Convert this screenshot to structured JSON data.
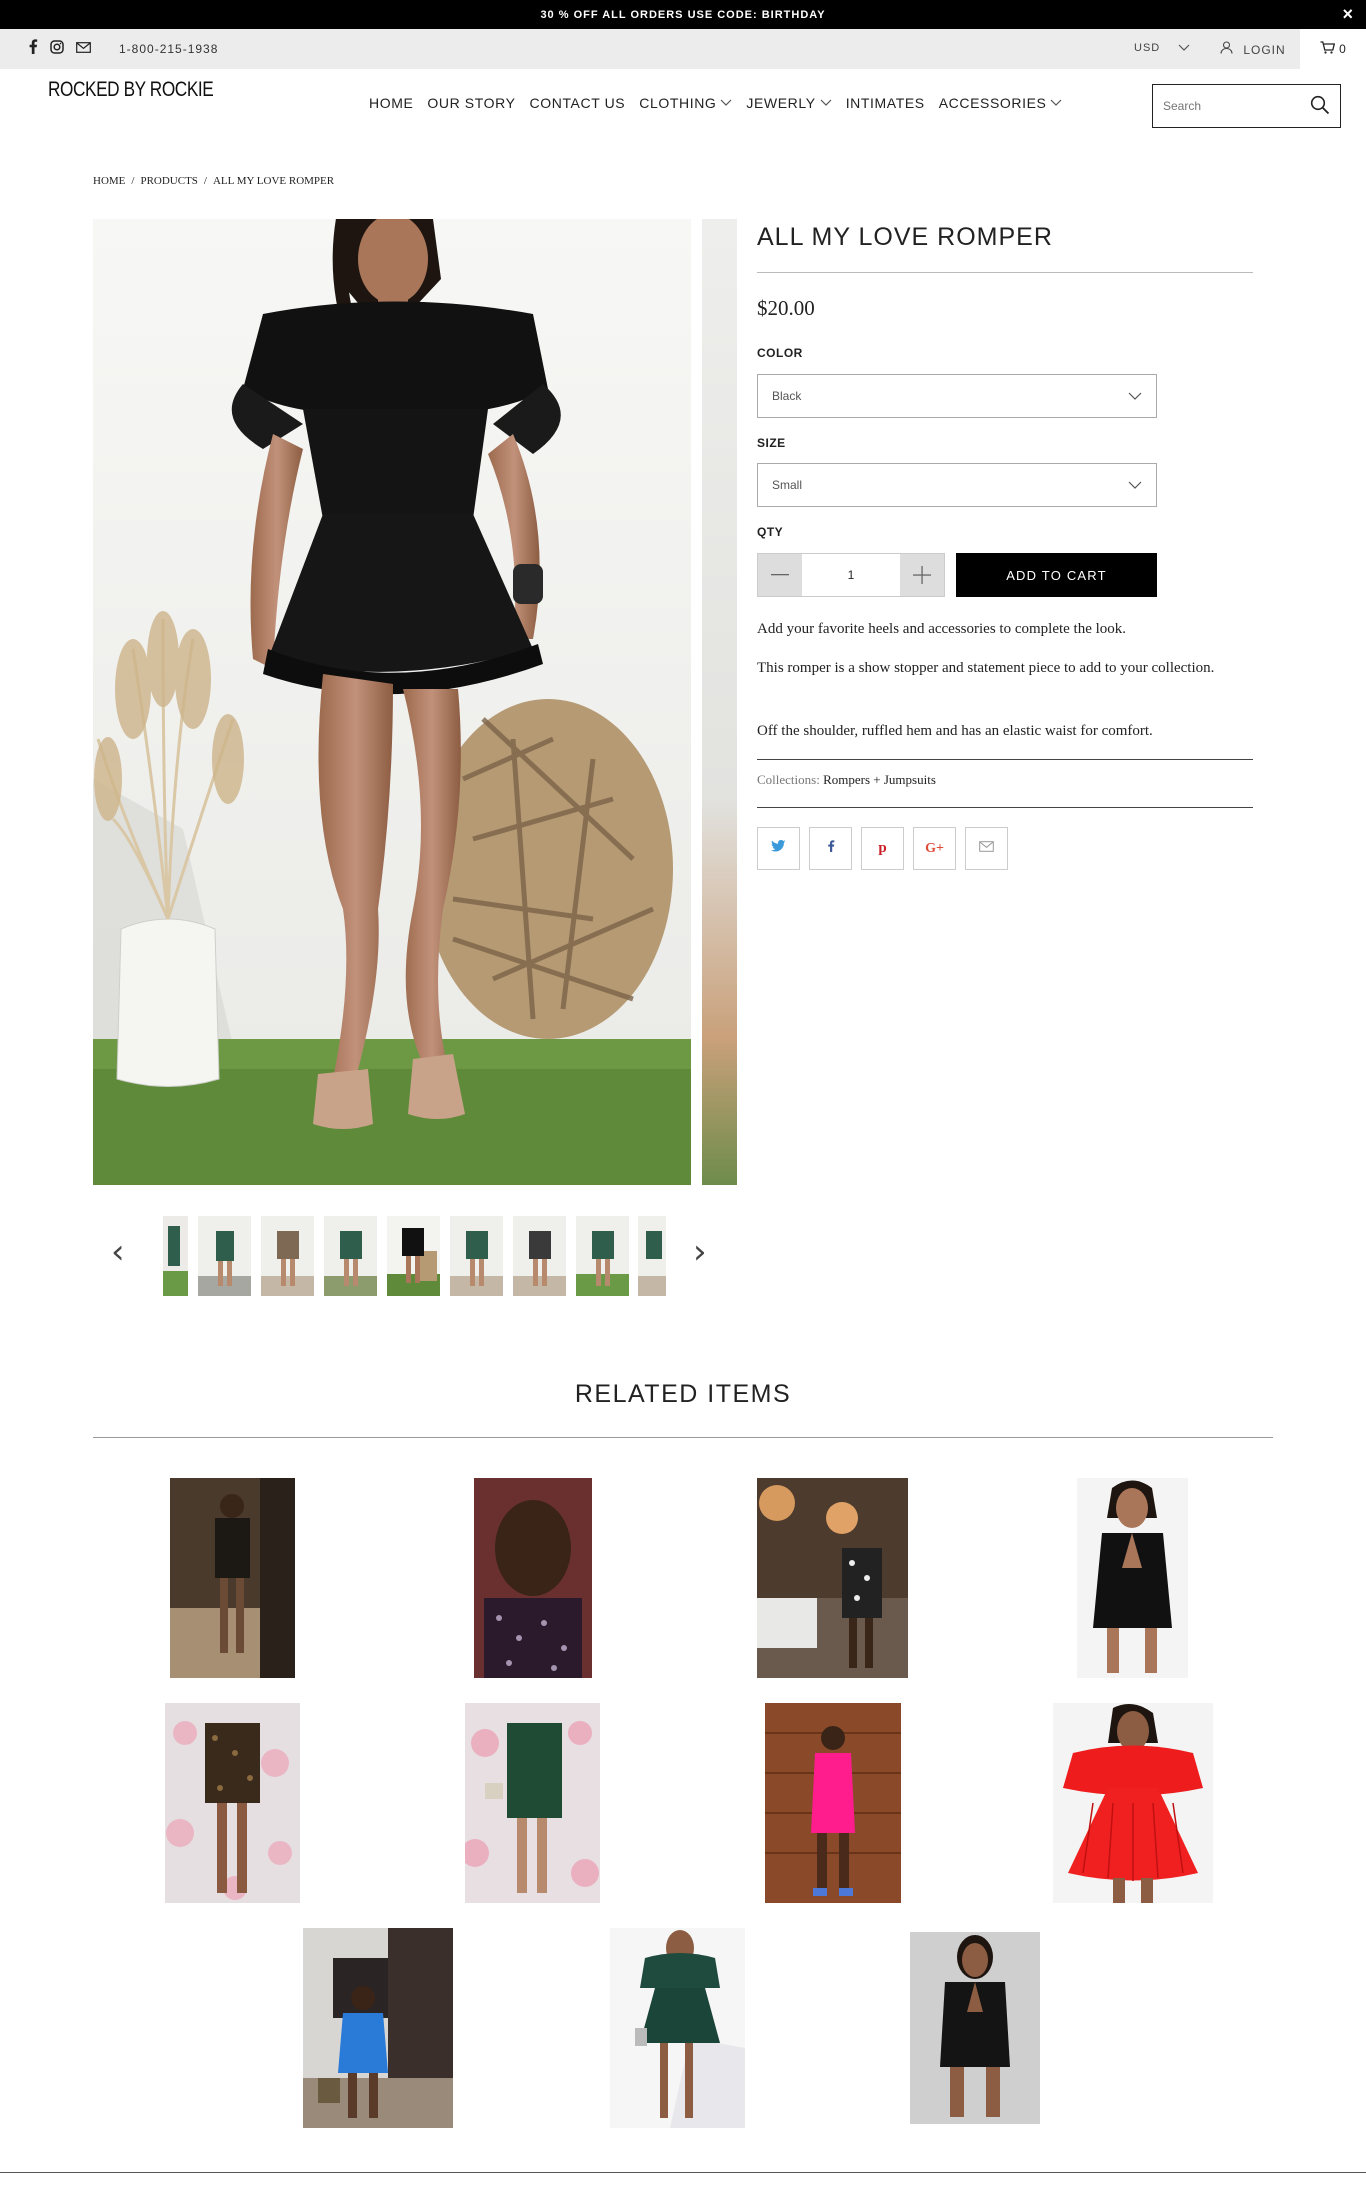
{
  "promo": {
    "text": "30 % OFF ALL ORDERS USE CODE: BIRTHDAY",
    "close": "×"
  },
  "topbar": {
    "phone": "1-800-215-1938",
    "currency": "USD",
    "login": "LOGIN",
    "cart_count": "0"
  },
  "brand": {
    "name": "ROCKED BY ROCKIE"
  },
  "nav": {
    "items": [
      {
        "label": "HOME"
      },
      {
        "label": "OUR STORY"
      },
      {
        "label": "CONTACT US"
      },
      {
        "label": "CLOTHING"
      },
      {
        "label": "JEWERLY"
      },
      {
        "label": "INTIMATES"
      },
      {
        "label": "ACCESSORIES"
      }
    ]
  },
  "search": {
    "placeholder": "Search"
  },
  "breadcrumb": {
    "home": "HOME",
    "products": "PRODUCTS",
    "current": "ALL MY LOVE ROMPER",
    "sep": "/"
  },
  "product": {
    "title": "ALL MY LOVE ROMPER",
    "price": "$20.00",
    "color_label": "COLOR",
    "color_value": "Black",
    "size_label": "SIZE",
    "size_value": "Small",
    "qty_label": "QTY",
    "qty_value": "1",
    "add_to_cart": "ADD TO CART",
    "description": [
      "Add your favorite heels and accessories to complete the look.",
      "This romper is a show stopper and statement piece to add to your collection.",
      "Off the shoulder, ruffled hem and has an elastic waist for comfort."
    ],
    "collections_label": "Collections:",
    "collections_value": "Rompers + Jumpsuits"
  },
  "share": {
    "twitter": "t",
    "facebook": "f",
    "pinterest": "p",
    "google": "G+",
    "email": "✉"
  },
  "related": {
    "title": "RELATED ITEMS"
  },
  "colors": {
    "accent": "#000000",
    "topbar_bg": "#ececec",
    "link_blue": "#3b9ad9",
    "pin_red": "#cb2027"
  }
}
